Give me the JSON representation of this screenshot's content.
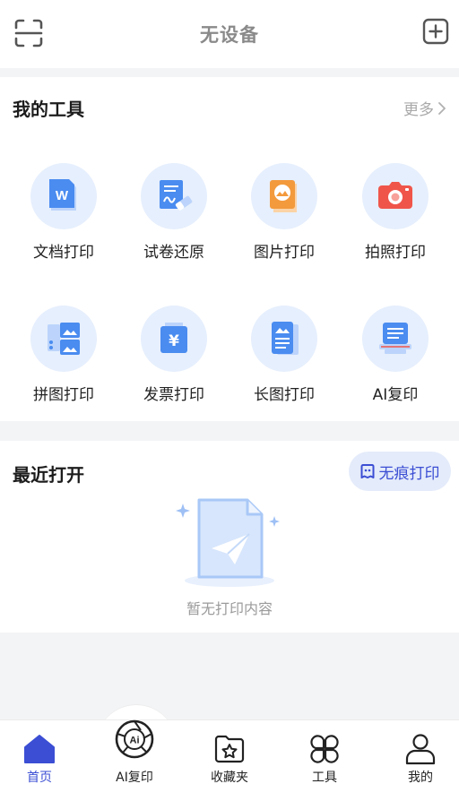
{
  "header": {
    "title": "无设备",
    "scan_icon": "scan-icon",
    "add_icon": "add-device-icon"
  },
  "tools": {
    "title": "我的工具",
    "more_label": "更多",
    "items": [
      {
        "label": "文档打印",
        "icon": "word-document-icon"
      },
      {
        "label": "试卷还原",
        "icon": "exam-paper-eraser-icon"
      },
      {
        "label": "图片打印",
        "icon": "image-print-icon"
      },
      {
        "label": "拍照打印",
        "icon": "camera-icon"
      },
      {
        "label": "拼图打印",
        "icon": "collage-icon"
      },
      {
        "label": "发票打印",
        "icon": "invoice-icon"
      },
      {
        "label": "长图打印",
        "icon": "long-image-icon"
      },
      {
        "label": "AI复印",
        "icon": "ai-copy-icon"
      }
    ]
  },
  "recent": {
    "title": "最近打开",
    "incognito_label": "无痕打印",
    "empty_text": "暂无打印内容"
  },
  "tabbar": {
    "items": [
      {
        "label": "首页",
        "icon": "home-icon",
        "active": true
      },
      {
        "label": "AI复印",
        "icon": "ai-lens-icon",
        "active": false
      },
      {
        "label": "收藏夹",
        "icon": "favorites-folder-icon",
        "active": false
      },
      {
        "label": "工具",
        "icon": "tools-grid-icon",
        "active": false
      },
      {
        "label": "我的",
        "icon": "profile-icon",
        "active": false
      }
    ]
  },
  "colors": {
    "accent": "#3b4ed4",
    "tool_circle_bg": "#e6effd",
    "tool_blue": "#4a8cf0",
    "tool_orange": "#f39a3d",
    "tool_red": "#f0554a",
    "page_bg": "#f3f4f6"
  }
}
